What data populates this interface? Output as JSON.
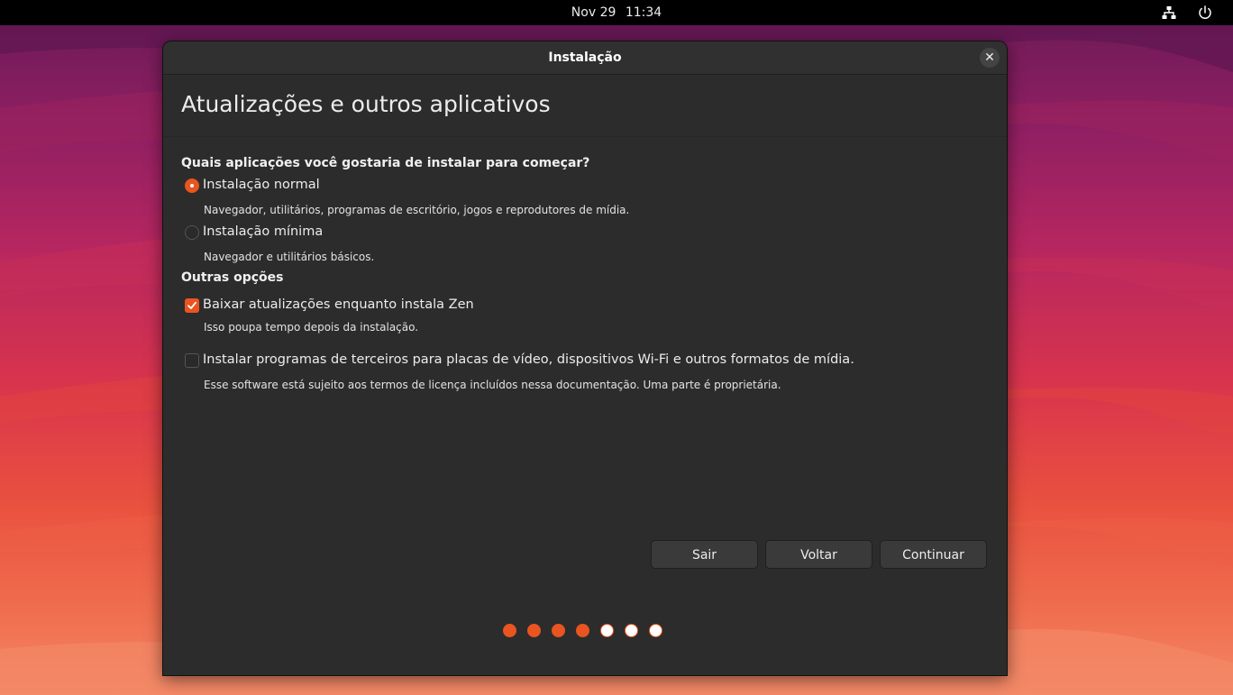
{
  "topbar": {
    "date": "Nov 29",
    "time": "11:34",
    "icons": [
      "network-icon",
      "power-icon"
    ]
  },
  "window": {
    "title": "Instalação",
    "close_icon": "close-icon"
  },
  "page": {
    "title": "Atualizações e outros aplicativos",
    "question": "Quais aplicações você gostaria de instalar para começar?",
    "install_options": [
      {
        "label": "Instalação normal",
        "description": "Navegador, utilitários, programas de escritório, jogos e reprodutores de mídia.",
        "selected": true
      },
      {
        "label": "Instalação mínima",
        "description": "Navegador e utilitários básicos.",
        "selected": false
      }
    ],
    "other_options_label": "Outras opções",
    "other_options": [
      {
        "label": "Baixar atualizações enquanto instala Zen",
        "description": "Isso poupa tempo depois da instalação.",
        "checked": true
      },
      {
        "label": "Instalar programas de terceiros para placas de vídeo, dispositivos Wi-Fi e outros formatos de mídia.",
        "description": "Esse software está sujeito aos termos de licença incluídos nessa documentação. Uma parte é proprietária.",
        "checked": false
      }
    ]
  },
  "buttons": {
    "quit": "Sair",
    "back": "Voltar",
    "continue": "Continuar"
  },
  "progress": {
    "total_steps": 7,
    "completed_steps": 4
  },
  "colors": {
    "accent": "#e95420",
    "window_bg": "#2c2c2c",
    "topbar_bg": "#000000"
  }
}
